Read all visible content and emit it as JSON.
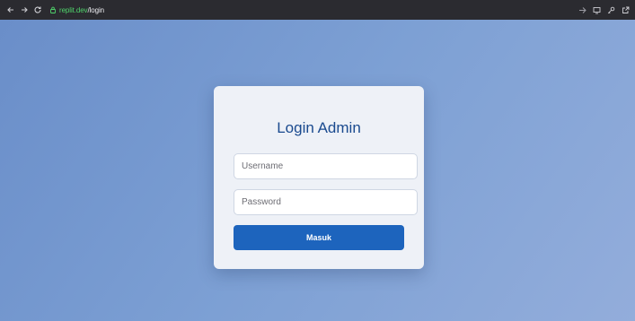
{
  "browser": {
    "url_host": "replit.dev",
    "url_path": "/login"
  },
  "login": {
    "title": "Login Admin",
    "username_placeholder": "Username",
    "password_placeholder": "Password",
    "submit_label": "Masuk"
  },
  "colors": {
    "accent": "#1d64bd",
    "title": "#1a4a8f",
    "card_bg": "#eef1f7",
    "bg_gradient_start": "#6a8ec9",
    "bg_gradient_end": "#93addb"
  },
  "icons": [
    "back-arrow-icon",
    "forward-arrow-icon",
    "reload-icon",
    "lock-icon",
    "cast-icon",
    "screen-icon",
    "key-icon",
    "open-external-icon"
  ]
}
